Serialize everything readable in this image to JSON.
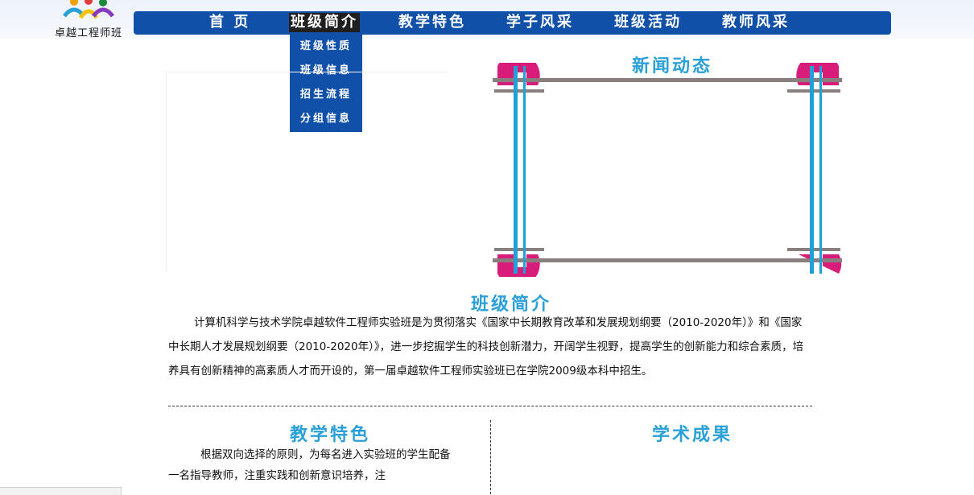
{
  "logo": {
    "text": "卓越工程师班"
  },
  "nav": {
    "items": [
      {
        "label": "首 页"
      },
      {
        "label": "班级简介"
      },
      {
        "label": "教学特色"
      },
      {
        "label": "学子风采"
      },
      {
        "label": "班级活动"
      },
      {
        "label": "教师风采"
      }
    ],
    "active_index": 1
  },
  "dropdown": {
    "items": [
      {
        "label": "班级性质"
      },
      {
        "label": "班级信息"
      },
      {
        "label": "招生流程"
      },
      {
        "label": "分组信息"
      }
    ]
  },
  "news": {
    "title": "新闻动态"
  },
  "intro": {
    "title": "班级简介",
    "text": "计算机科学与技术学院卓越软件工程师实验班是为贯彻落实《国家中长期教育改革和发展规划纲要（2010-2020年）》和《国家中长期人才发展规划纲要（2010-2020年）》，进一步挖掘学生的科技创新潜力，开阔学生视野，提高学生的创新能力和综合素质，培养具有创新精神的高素质人才而开设的，第一届卓越软件工程师实验班已在学院2009级本科中招生。"
  },
  "teaching": {
    "title": "教学特色",
    "text": "根据双向选择的原则，为每名进入实验班的学生配备一名指导教师，注重实践和创新意识培养，注"
  },
  "academic": {
    "title": "学术成果"
  },
  "colors": {
    "nav_bg": "#1050a8",
    "title_blue": "#2aa0d6",
    "frame_blue": "#1fa0d8",
    "frame_gray": "#8a7f7f",
    "frame_pink": "#d81c7a"
  }
}
